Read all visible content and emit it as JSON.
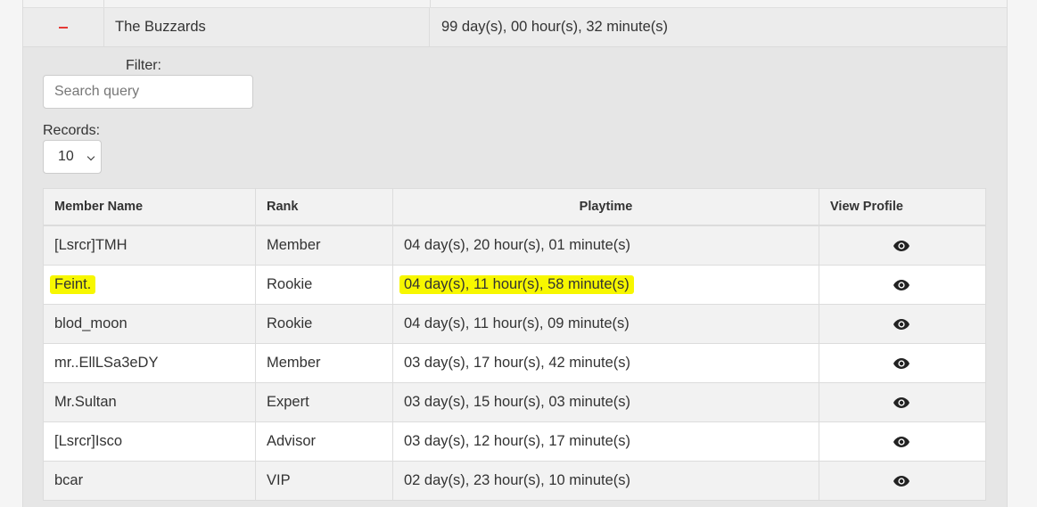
{
  "clan": {
    "toggle_symbol": "−",
    "name": "The Buzzards",
    "playtime": "99 day(s), 00 hour(s), 32 minute(s)"
  },
  "filter": {
    "label": "Filter:",
    "placeholder": "Search query"
  },
  "records": {
    "label": "Records:",
    "selected": "10"
  },
  "table": {
    "headers": [
      "Member Name",
      "Rank",
      "Playtime",
      "View Profile"
    ],
    "rows": [
      {
        "name": "[Lsrcr]TMH",
        "rank": "Member",
        "playtime": "04 day(s), 20 hour(s), 01 minute(s)",
        "icon": "eye-icon"
      },
      {
        "name": "Feint.",
        "rank": "Rookie",
        "playtime": "04 day(s), 11 hour(s), 58 minute(s)",
        "icon": "eye-icon",
        "highlighted": true
      },
      {
        "name": "blod_moon",
        "rank": "Rookie",
        "playtime": "04 day(s), 11 hour(s), 09 minute(s)",
        "icon": "eye-icon"
      },
      {
        "name": "mr..EllLSa3eDY",
        "rank": "Member",
        "playtime": "03 day(s), 17 hour(s), 42 minute(s)",
        "icon": "eye-icon"
      },
      {
        "name": "Mr.Sultan",
        "rank": "Expert",
        "playtime": "03 day(s), 15 hour(s), 03 minute(s)",
        "icon": "eye-icon"
      },
      {
        "name": "[Lsrcr]Isco",
        "rank": "Advisor",
        "playtime": "03 day(s), 12 hour(s), 17 minute(s)",
        "icon": "eye-icon"
      },
      {
        "name": "bcar",
        "rank": "VIP",
        "playtime": "02 day(s), 23 hour(s), 10 minute(s)",
        "icon": "eye-icon"
      }
    ]
  },
  "colors": {
    "highlight": "#f7f700",
    "collapse": "#e53935"
  }
}
